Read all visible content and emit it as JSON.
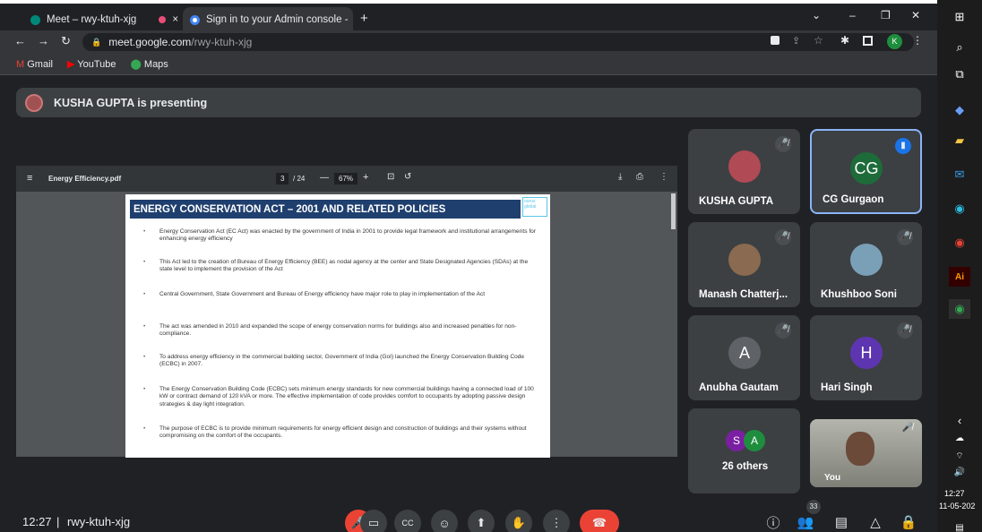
{
  "tabs": [
    {
      "title": "Meet – rwy-ktuh-xjg",
      "close": "×"
    },
    {
      "title": "Sign in to your Admin console - ",
      "close": "×"
    }
  ],
  "new_tab": "+",
  "window_controls": {
    "chevron": "⌄",
    "minimize": "–",
    "restore": "❐",
    "close": "✕"
  },
  "address_bar": {
    "domain": "meet.google.com",
    "path": "/rwy-ktuh-xjg",
    "profile_initial": "K"
  },
  "bookmarks": [
    "Gmail",
    "YouTube",
    "Maps"
  ],
  "presenting_banner": "KUSHA GUPTA is presenting",
  "pdf": {
    "filename": "Energy Efficiency.pdf",
    "page_current": "3",
    "page_total": "/ 24",
    "zoom": "67%",
    "slide_title": "ENERGY CONSERVATION ACT – 2001 AND RELATED POLICIES",
    "logo_text": "ourus global",
    "bullets": [
      "Energy Conservation Act (EC Act) was enacted by the government of India in 2001 to provide legal framework and institutional arrangements for enhancing energy efficiency",
      "This Act led to the creation of Bureau of Energy Efficiency (BEE) as nodal agency at the center and State Designated Agencies (SDAs) at the state level to implement the provision of the Act",
      "Central Government, State Government and Bureau of Energy efficiency have major role to play in implementation of the Act",
      "The act was amended in 2010 and expanded the scope of energy conservation norms for buildings also and increased penalties for non-compliance.",
      "To address energy efficiency in the commercial building sector, Government of India (GoI) launched the Energy Conservation Building Code (ECBC) in 2007.",
      "The Energy Conservation Building Code (ECBC) sets minimum energy standards for new commercial buildings having a connected load of 100 kW or contract demand of 120 kVA or more. The effective implementation of code provides comfort to occupants by adopting passive design strategies & day light integration.",
      "The purpose of ECBC is to provide minimum requirements for energy efficient design and construction of buildings and their systems without compromising on the comfort of the occupants."
    ]
  },
  "participants": [
    {
      "name": "KUSHA GUPTA",
      "initial": "",
      "color": "#b04a55"
    },
    {
      "name": "CG Gurgaon",
      "initial": "CG",
      "color": "#1e6b3a"
    },
    {
      "name": "Manash Chatterj...",
      "initial": "",
      "color": "#8a6a50"
    },
    {
      "name": "Khushboo Soni",
      "initial": "",
      "color": "#7aa0b8"
    },
    {
      "name": "Anubha Gautam",
      "initial": "A",
      "color": "#5f6368"
    },
    {
      "name": "Hari Singh",
      "initial": "H",
      "color": "#5e35b1"
    }
  ],
  "others": {
    "label": "26 others",
    "initials": [
      "S",
      "A"
    ]
  },
  "self_view": {
    "label": "You",
    "count": "33"
  },
  "meeting_footer": {
    "time": "12:27",
    "separator": "|",
    "code": "rwy-ktuh-xjg"
  },
  "taskbar": {
    "time": "12:27",
    "date": "11-05-202"
  }
}
